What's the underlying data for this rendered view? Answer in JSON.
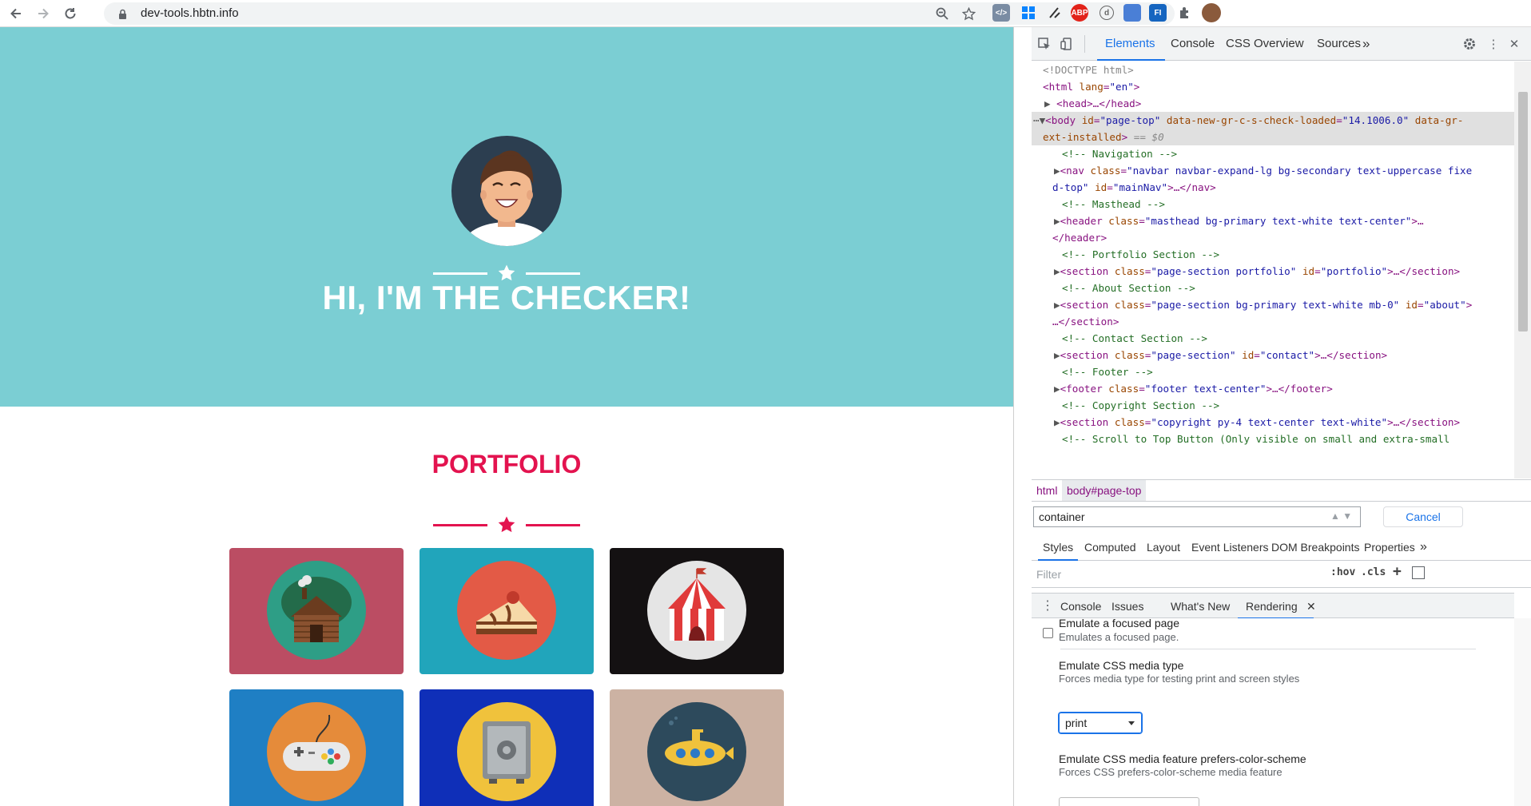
{
  "browser": {
    "url": "dev-tools.hbtn.info"
  },
  "page": {
    "hero_title": "HI, I'M THE CHECKER!",
    "portfolio_title": "PORTFOLIO",
    "colors": {
      "masthead": "#7bced3",
      "accent": "#e3134f",
      "white": "#ffffff"
    },
    "tiles": [
      {
        "name": "cabin",
        "bg": "#bb4d63",
        "circle": "#2e9e86"
      },
      {
        "name": "cake",
        "bg": "#21a5bb",
        "circle": "#e35a46"
      },
      {
        "name": "circus",
        "bg": "#141112",
        "circle": "#e5e5e5"
      },
      {
        "name": "game-controller",
        "bg": "#1f7fc4",
        "circle": "#e58b3a"
      },
      {
        "name": "safe",
        "bg": "#0f2fb8",
        "circle": "#f0c23c"
      },
      {
        "name": "submarine",
        "bg": "#ccb2a3",
        "circle": "#2d4a5c"
      }
    ]
  },
  "devtools": {
    "tabs": [
      "Elements",
      "Console",
      "CSS Overview",
      "Sources"
    ],
    "more_tabs": "»",
    "dom": {
      "doctype": "<!DOCTYPE html>",
      "html_open": [
        "<html",
        "lang",
        "\"en\"",
        ">"
      ],
      "head": "<head>…</head>",
      "body_attrs": [
        "id",
        "\"page-top\"",
        "data-new-gr-c-s-check-loaded",
        "\"14.1006.0\"",
        "data-gr-"
      ],
      "body_cont": "ext-installed",
      "body_eq": "== $0",
      "comments": [
        "<!-- Navigation -->",
        "<!-- Masthead -->",
        "<!-- Portfolio Section -->",
        "<!-- About Section -->",
        "<!-- Contact Section -->",
        "<!-- Footer -->",
        "<!-- Copyright Section -->",
        "<!-- Scroll to Top Button (Only visible on small and extra-small"
      ],
      "nav_class": "\"navbar navbar-expand-lg bg-secondary text-uppercase fixe",
      "nav_cont": "d-top\"",
      "nav_id": "\"mainNav\"",
      "header_class": "\"masthead bg-primary text-white text-center\"",
      "portfolio_class": "\"page-section portfolio\"",
      "portfolio_id": "\"portfolio\"",
      "about_class": "\"page-section bg-primary text-white mb-0\"",
      "about_id": "\"about\"",
      "contact_class": "\"page-section\"",
      "contact_id": "\"contact\"",
      "footer_class": "\"footer text-center\"",
      "copyright_class": "\"copyright py-4 text-center text-white\""
    },
    "breadcrumbs": [
      "html",
      "body#page-top"
    ],
    "search": {
      "value": "container",
      "cancel": "Cancel"
    },
    "styles_tabs": [
      "Styles",
      "Computed",
      "Layout",
      "Event Listeners",
      "DOM Breakpoints",
      "Properties"
    ],
    "filter": {
      "placeholder": "Filter",
      "hov": ":hov",
      "cls": ".cls",
      "plus": "+"
    },
    "drawer_tabs": [
      "Console",
      "Issues",
      "What's New",
      "Rendering"
    ],
    "rendering": {
      "focused_title": "Emulate a focused page",
      "focused_desc": "Emulates a focused page.",
      "media_title": "Emulate CSS media type",
      "media_desc": "Forces media type for testing print and screen styles",
      "media_value": "print",
      "scheme_title": "Emulate CSS media feature prefers-color-scheme",
      "scheme_desc": "Forces CSS prefers-color-scheme media feature"
    }
  }
}
